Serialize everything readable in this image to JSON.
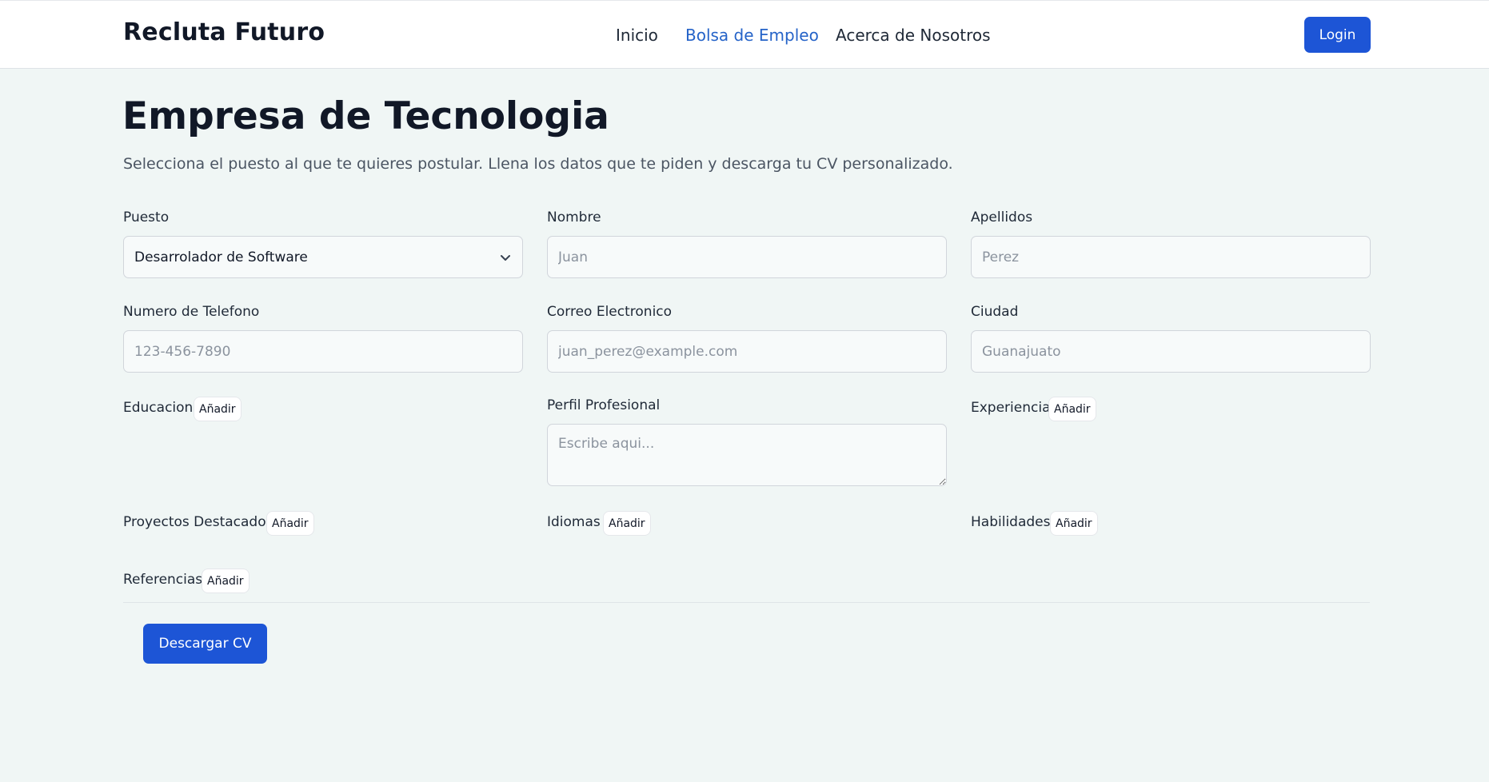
{
  "header": {
    "brand": "Recluta Futuro",
    "nav": [
      "Inicio",
      "Bolsa de Empleo",
      "Acerca de Nosotros"
    ],
    "active_nav": "Bolsa de Empleo",
    "login_label": "Login"
  },
  "page": {
    "title": "Empresa de Tecnologia",
    "subtitle": "Selecciona el puesto al que te quieres postular. Llena los datos que te piden y descarga tu CV personalizado."
  },
  "form": {
    "puesto": {
      "label": "Puesto",
      "value": "Desarrolador de Software"
    },
    "nombre": {
      "label": "Nombre",
      "placeholder": "Juan"
    },
    "apellidos": {
      "label": "Apellidos",
      "placeholder": "Perez"
    },
    "telefono": {
      "label": "Numero de Telefono",
      "placeholder": "123-456-7890"
    },
    "correo": {
      "label": "Correo Electronico",
      "placeholder": "juan_perez@example.com"
    },
    "ciudad": {
      "label": "Ciudad",
      "placeholder": "Guanajuato"
    },
    "perfil": {
      "label": "Perfil Profesional",
      "placeholder": "Escribe aqui..."
    },
    "sections": {
      "educacion": "Educacion",
      "experiencia": "Experiencia",
      "proyectos": "Proyectos Destacados",
      "idiomas": "Idiomas",
      "habilidades": "Habilidades",
      "referencias": "Referencias"
    },
    "add_label": "Añadir",
    "download_label": "Descargar CV"
  },
  "colors": {
    "primary": "#1d55d6",
    "active_link": "#2563c8",
    "background": "#f0f6f5"
  }
}
